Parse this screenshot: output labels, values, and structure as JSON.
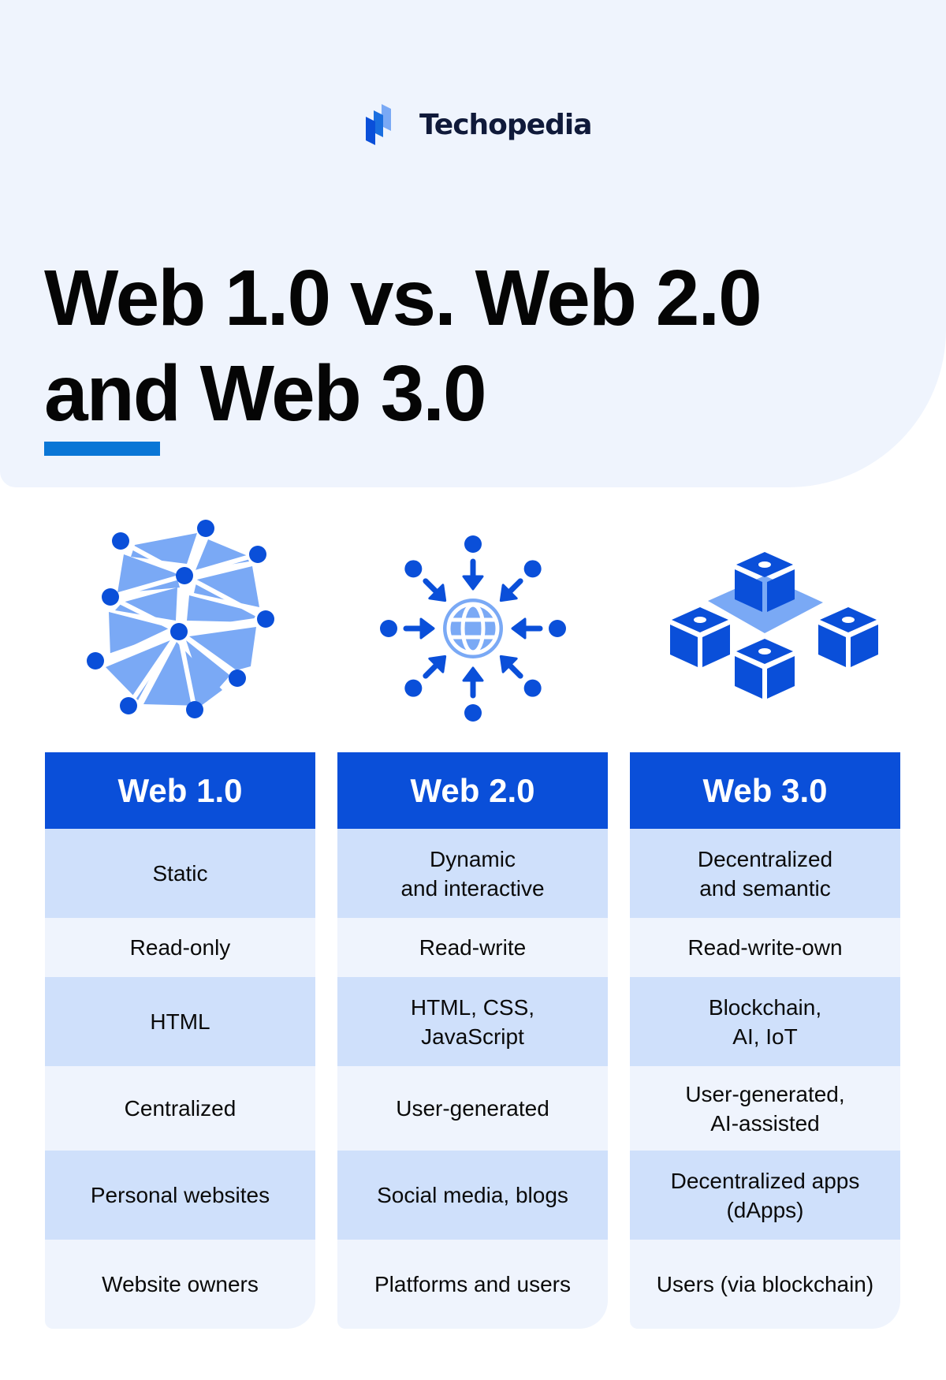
{
  "brand": {
    "name": "Techopedia",
    "icon": "techopedia-logo-icon"
  },
  "title": {
    "line1": "Web 1.0 vs. Web 2.0",
    "line2": "and Web 3.0"
  },
  "colors": {
    "primary_blue": "#0a4fd9",
    "accent_underline": "#0a76d6",
    "light_blue": "#7aa9f5",
    "shaded_row": "#cfe0fb",
    "light_row": "#eff4fd",
    "hero_bg": "#eff4fd"
  },
  "icons": [
    "network-mesh-icon",
    "globe-inbound-arrows-icon",
    "blockchain-cubes-icon"
  ],
  "columns": [
    {
      "header": "Web 1.0",
      "cells": [
        "Static",
        "Read-only",
        "HTML",
        "Centralized",
        "Personal websites",
        "Website owners"
      ]
    },
    {
      "header": "Web 2.0",
      "cells": [
        "Dynamic\nand interactive",
        "Read-write",
        "HTML, CSS,\nJavaScript",
        "User-generated",
        "Social media, blogs",
        "Platforms and users"
      ]
    },
    {
      "header": "Web 3.0",
      "cells": [
        "Decentralized\nand semantic",
        "Read-write-own",
        "Blockchain,\nAI, IoT",
        "User-generated,\nAI-assisted",
        "Decentralized apps\n(dApps)",
        "Users (via blockchain)"
      ]
    }
  ]
}
